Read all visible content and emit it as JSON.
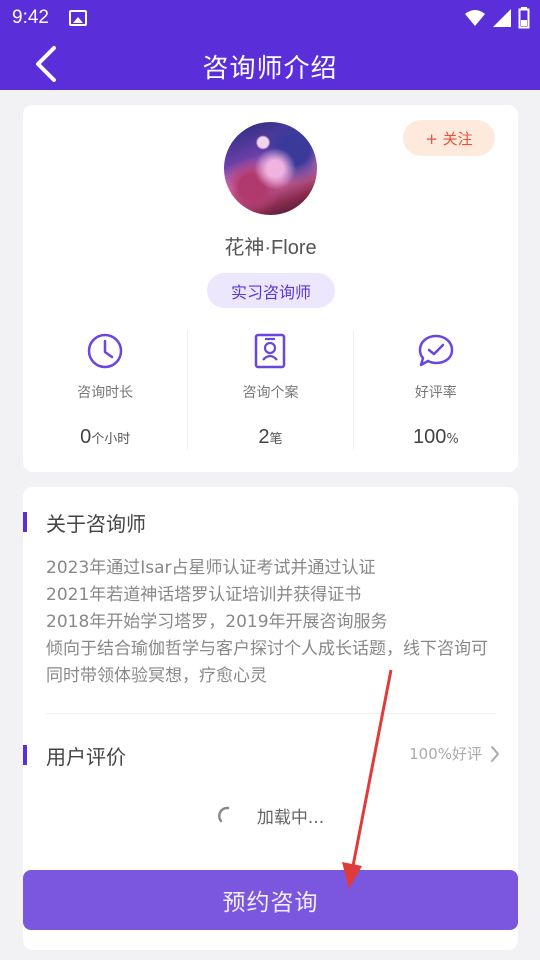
{
  "status_bar": {
    "time": "9:42",
    "icons": [
      "image-icon",
      "wifi-icon",
      "signal-icon",
      "battery-icon"
    ]
  },
  "header": {
    "title": "咨询师介绍",
    "back_icon": "chevron-left-icon"
  },
  "profile": {
    "follow_label": "+ 关注",
    "name": "花神·Flore",
    "badge": "实习咨询师",
    "stats": [
      {
        "icon": "clock-icon",
        "label": "咨询时长",
        "value": "0",
        "unit": "个小时"
      },
      {
        "icon": "id-card-icon",
        "label": "咨询个案",
        "value": "2",
        "unit": "笔"
      },
      {
        "icon": "chat-check-icon",
        "label": "好评率",
        "value": "100",
        "unit": "%"
      }
    ]
  },
  "about": {
    "title": "关于咨询师",
    "text": "2023年通过Isar占星师认证考试并通过认证\n2021年若道神话塔罗认证培训并获得证书\n2018年开始学习塔罗，2019年开展咨询服务\n倾向于结合瑜伽哲学与客户探讨个人成长话题，线下咨询可同时带领体验冥想，疗愈心灵"
  },
  "reviews": {
    "title": "用户评价",
    "summary": "100%好评",
    "loading": "加载中..."
  },
  "actions": {
    "book_label": "预约咨询"
  },
  "colors": {
    "primary": "#5a2fd9",
    "button": "#7b57e0",
    "follow_bg": "#fdeadd",
    "follow_text": "#e2533a",
    "annotation": "#e03b3b"
  }
}
